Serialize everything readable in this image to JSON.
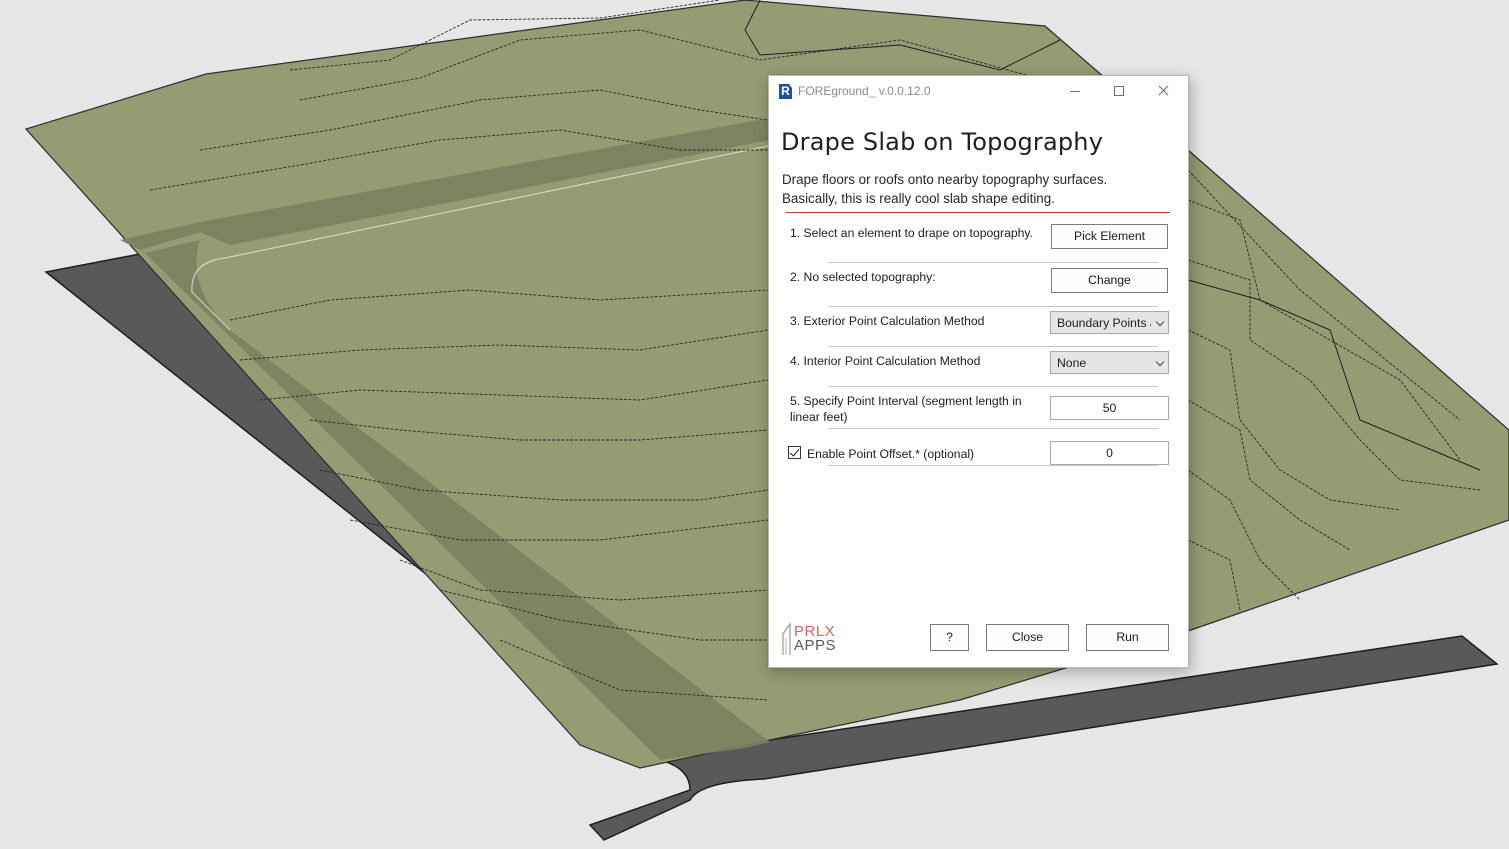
{
  "window": {
    "title": "FOREground_ v.0.0.12.0"
  },
  "dialog": {
    "heading": "Drape Slab on Topography",
    "description_line1": "Drape floors or roofs onto nearby topography surfaces.",
    "description_line2": "Basically, this is really cool slab shape editing.",
    "accent_color": "#c0353b",
    "rows": {
      "select_element": {
        "label": "1. Select an element to drape on topography.",
        "button": "Pick Element"
      },
      "topography": {
        "label": "2. No selected topography:",
        "button": "Change"
      },
      "exterior_method": {
        "label": "3. Exterior Point Calculation Method",
        "value": "Boundary Points along edges"
      },
      "interior_method": {
        "label": "4. Interior Point Calculation Method",
        "value": "None"
      },
      "point_interval": {
        "label": "5. Specify Point Interval (segment length in linear feet)",
        "value": "50"
      },
      "point_offset": {
        "label": "Enable Point Offset.* (optional)",
        "checked": true,
        "value": "0"
      }
    },
    "logo": {
      "line1": "PRLX",
      "line2": "APPS"
    },
    "footer": {
      "help_label": "?",
      "close_label": "Close",
      "run_label": "Run"
    }
  },
  "icons": {
    "app": "revit-icon",
    "minimize": "minimize-icon",
    "maximize": "maximize-icon",
    "close": "close-icon",
    "dropdown": "chevron-down-icon",
    "check": "checkmark-icon"
  },
  "colors": {
    "background": "#e6e6e6",
    "topography": "#949c73",
    "slab": "#5c5c5c"
  }
}
